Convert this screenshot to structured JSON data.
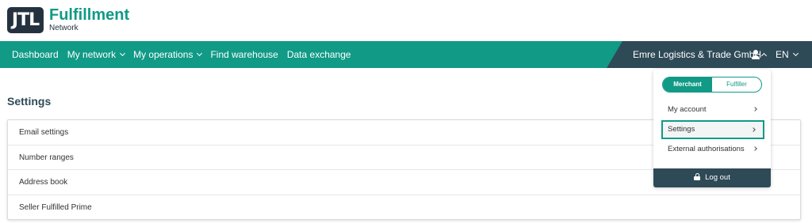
{
  "logo": {
    "mark": "JTL",
    "title": "Fulfillment",
    "subtitle": "Network"
  },
  "nav": {
    "items": [
      {
        "label": "Dashboard",
        "dropdown": false
      },
      {
        "label": "My network",
        "dropdown": true
      },
      {
        "label": "My operations",
        "dropdown": true
      },
      {
        "label": "Find warehouse",
        "dropdown": false
      },
      {
        "label": "Data exchange",
        "dropdown": false
      }
    ],
    "company": "Emre Logistics & Trade GmbH",
    "language": "EN"
  },
  "page": {
    "title": "Settings",
    "rows": [
      "Email settings",
      "Number ranges",
      "Address book",
      "Seller Fulfilled Prime"
    ]
  },
  "dropdown": {
    "toggle": {
      "merchant": "Merchant",
      "fulfiller": "Fulfiller",
      "active": "Merchant"
    },
    "items": [
      "My account",
      "Settings",
      "External authorisations"
    ],
    "selected": "Settings",
    "logout": "Log out"
  },
  "colors": {
    "brand_green": "#119a86",
    "dark_slate": "#2f4a57",
    "logo_bg": "#243240"
  }
}
